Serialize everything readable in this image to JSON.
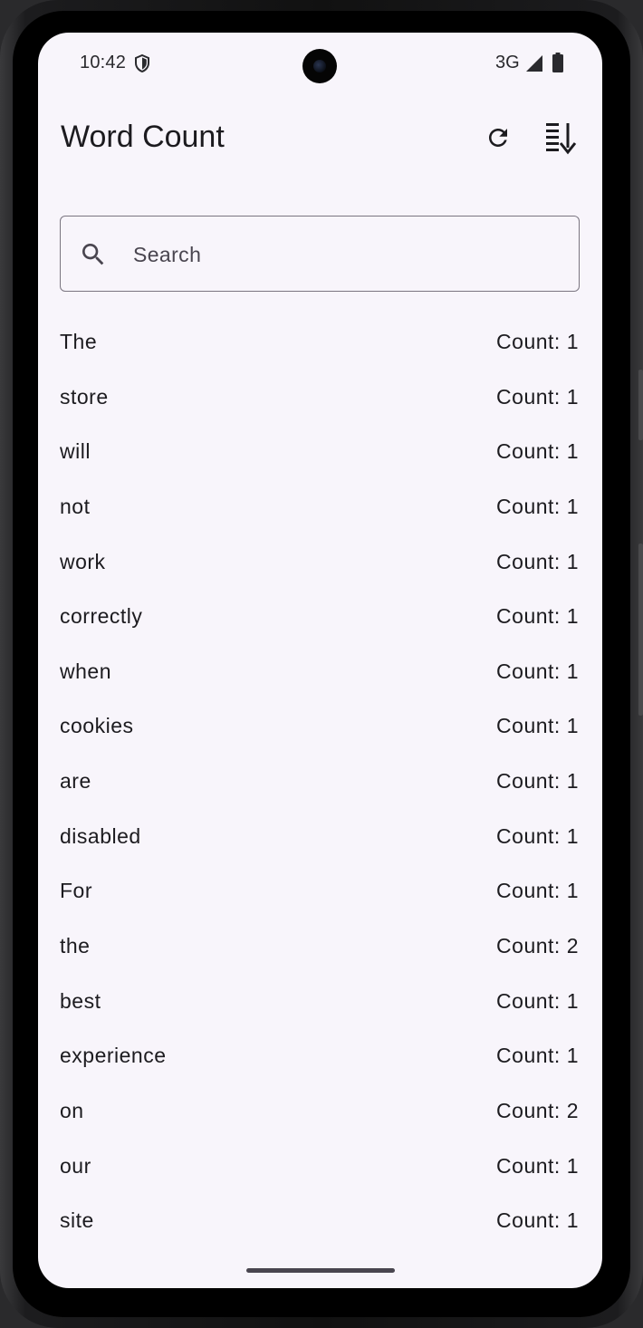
{
  "status_bar": {
    "time": "10:42",
    "network": "3G"
  },
  "app_bar": {
    "title": "Word Count",
    "refresh_icon": "refresh-icon",
    "sort_icon": "sort-icon"
  },
  "search": {
    "placeholder": "Search",
    "value": ""
  },
  "words": [
    {
      "word": "The",
      "count": "Count: 1"
    },
    {
      "word": "store",
      "count": "Count: 1"
    },
    {
      "word": "will",
      "count": "Count: 1"
    },
    {
      "word": "not",
      "count": "Count: 1"
    },
    {
      "word": "work",
      "count": "Count: 1"
    },
    {
      "word": "correctly",
      "count": "Count: 1"
    },
    {
      "word": "when",
      "count": "Count: 1"
    },
    {
      "word": "cookies",
      "count": "Count: 1"
    },
    {
      "word": "are",
      "count": "Count: 1"
    },
    {
      "word": "disabled",
      "count": "Count: 1"
    },
    {
      "word": "For",
      "count": "Count: 1"
    },
    {
      "word": "the",
      "count": "Count: 2"
    },
    {
      "word": "best",
      "count": "Count: 1"
    },
    {
      "word": "experience",
      "count": "Count: 1"
    },
    {
      "word": "on",
      "count": "Count: 2"
    },
    {
      "word": "our",
      "count": "Count: 1"
    },
    {
      "word": "site",
      "count": "Count: 1"
    }
  ],
  "colors": {
    "background": "#f8f5fb",
    "text": "#1c1b1f",
    "outline": "#7a7580"
  }
}
